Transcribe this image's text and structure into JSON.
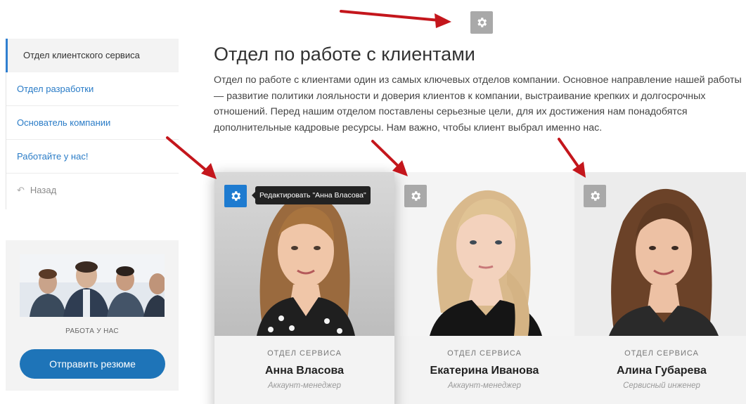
{
  "sidebar": {
    "items": [
      {
        "label": "Отдел клиентского сервиса"
      },
      {
        "label": "Отдел разработки"
      },
      {
        "label": "Основатель компании"
      },
      {
        "label": "Работайте у нас!"
      }
    ],
    "back": {
      "label": "Назад",
      "icon": "back-arrow-icon"
    }
  },
  "promo": {
    "title": "РАБОТА У НАС",
    "button": "Отправить резюме"
  },
  "main": {
    "title": "Отдел по работе с клиентами",
    "lead": "Отдел по работе с клиентами один из самых ключевых отделов компании. Основное направление нашей работы — развитие политики лояльности и доверия клиентов к компании, выстраивание крепких и долгосрочных отношений. Перед нашим отделом поставлены серьезные цели, для их достижения нам понадобятся дополнительные кадровые ресурсы. Нам важно, чтобы клиент выбрал именно нас."
  },
  "cards": [
    {
      "dept": "ОТДЕЛ СЕРВИСА",
      "name": "Анна Власова",
      "role": "Аккаунт-менеджер",
      "tooltip": "Редактировать \"Анна Власова\""
    },
    {
      "dept": "ОТДЕЛ СЕРВИСА",
      "name": "Екатерина Иванова",
      "role": "Аккаунт-менеджер"
    },
    {
      "dept": "ОТДЕЛ СЕРВИСА",
      "name": "Алина Губарева",
      "role": "Сервисный инженер"
    }
  ],
  "colors": {
    "accent": "#1e74b8",
    "gear_idle": "#a9a9a9",
    "gear_active": "#1e7bd0",
    "arrow": "#c4161c"
  }
}
